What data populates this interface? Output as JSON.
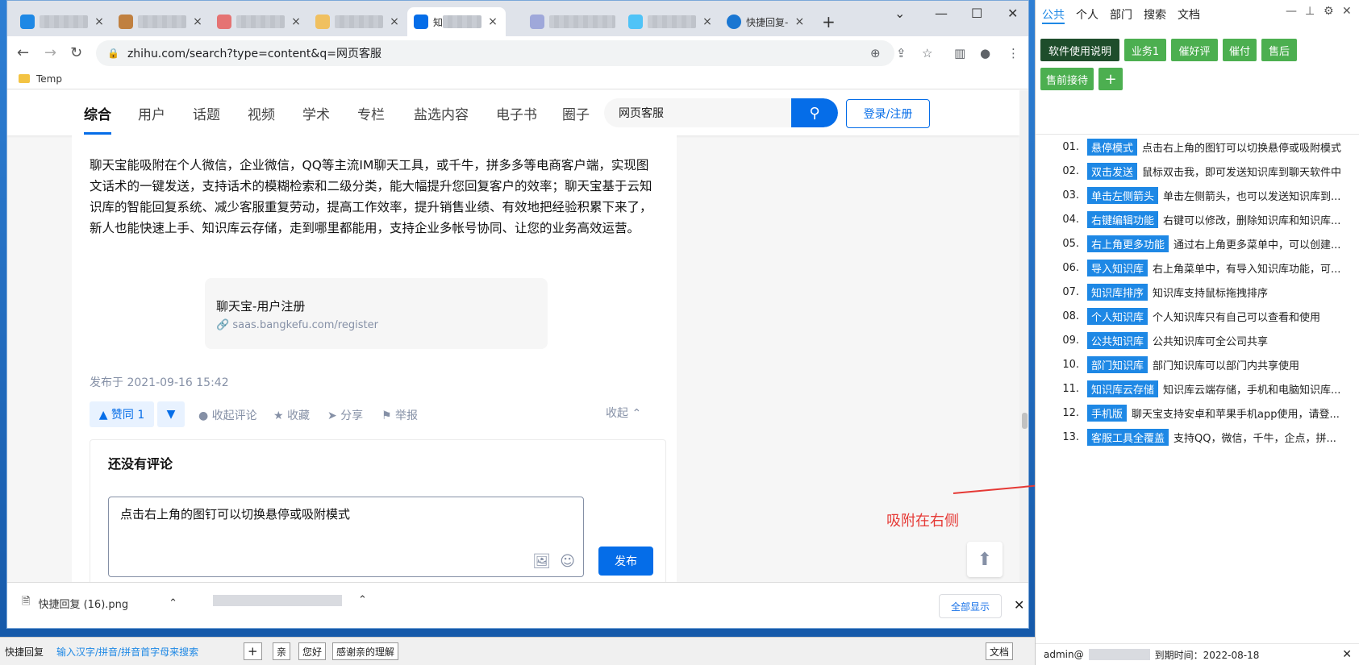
{
  "browser": {
    "tabs": [
      {
        "label": "",
        "close": "×",
        "color": "#1e88e5"
      },
      {
        "label": "",
        "close": "×",
        "color": "#c08040"
      },
      {
        "label": "",
        "close": "×",
        "color": "#e57373"
      },
      {
        "label": "",
        "close": "×",
        "color": "#f0c060"
      },
      {
        "label": "知 ",
        "close": "×",
        "color": "#056de8"
      },
      {
        "label": "",
        "close": "",
        "color": "#9fa8da"
      },
      {
        "label": "",
        "close": "×",
        "color": "#4fc3f7"
      },
      {
        "label": "快捷回复-",
        "close": "×",
        "color": "#1976d2"
      }
    ],
    "new_tab": "+",
    "url": "zhihu.com/search?type=content&q=网页客服",
    "bookmark": "Temp"
  },
  "zhihu": {
    "tabs": [
      "综合",
      "用户",
      "话题",
      "视频",
      "学术",
      "专栏",
      "盐选内容",
      "电子书",
      "圈子"
    ],
    "search_value": "网页客服",
    "login": "登录/注册",
    "answer": "聊天宝能吸附在个人微信，企业微信，QQ等主流IM聊天工具，或千牛，拼多多等电商客户端，实现图文话术的一键发送，支持话术的模糊检索和二级分类，能大幅提升您回复客户的效率；聊天宝基于云知识库的智能回复系统、减少客服重复劳动，提高工作效率，提升销售业绩、有效地把经验积累下来了，新人也能快速上手、知识库云存储，走到哪里都能用，支持企业多帐号协同、让您的业务高效运营。",
    "link_title": "聊天宝-用户注册",
    "link_url": "saas.bangkefu.com/register",
    "publish_time": "发布于 2021-09-16 15:42",
    "vote_up": "▲ 赞同 1",
    "vote_down": "▼",
    "actions": [
      "收起评论",
      "收藏",
      "分享",
      "举报"
    ],
    "collapse": "收起",
    "no_comment": "还没有评论",
    "comment_text": "点击右上角的图钉可以切换悬停或吸附模式",
    "post": "发布"
  },
  "annotation": "吸附在右侧",
  "downloads": {
    "file1": "快捷回复 (16).png",
    "show_all": "全部显示"
  },
  "panel": {
    "tabs": [
      "公共",
      "个人",
      "部门",
      "搜索",
      "文档"
    ],
    "buttons": [
      {
        "label": "软件使用说明",
        "color": "#1e4d2b"
      },
      {
        "label": "业务1",
        "color": "#4caf50"
      },
      {
        "label": "催好评",
        "color": "#4caf50"
      },
      {
        "label": "催付",
        "color": "#4caf50"
      },
      {
        "label": "售后",
        "color": "#4caf50"
      },
      {
        "label": "售前接待",
        "color": "#4caf50"
      },
      {
        "label": "+",
        "color": "#4caf50"
      }
    ],
    "items": [
      {
        "num": "01.",
        "tag": "悬停模式",
        "desc": "点击右上角的图钉可以切换悬停或吸附模式"
      },
      {
        "num": "02.",
        "tag": "双击发送",
        "desc": "鼠标双击我，即可发送知识库到聊天软件中"
      },
      {
        "num": "03.",
        "tag": "单击左侧箭头",
        "desc": "单击左侧箭头，也可以发送知识库到..."
      },
      {
        "num": "04.",
        "tag": "右键编辑功能",
        "desc": "右键可以修改，删除知识库和知识库..."
      },
      {
        "num": "05.",
        "tag": "右上角更多功能",
        "desc": "通过右上角更多菜单中，可以创建..."
      },
      {
        "num": "06.",
        "tag": "导入知识库",
        "desc": "右上角菜单中，有导入知识库功能，可..."
      },
      {
        "num": "07.",
        "tag": "知识库排序",
        "desc": "知识库支持鼠标拖拽排序"
      },
      {
        "num": "08.",
        "tag": "个人知识库",
        "desc": "个人知识库只有自己可以查看和使用"
      },
      {
        "num": "09.",
        "tag": "公共知识库",
        "desc": "公共知识库可全公司共享"
      },
      {
        "num": "10.",
        "tag": "部门知识库",
        "desc": "部门知识库可以部门内共享使用"
      },
      {
        "num": "11.",
        "tag": "知识库云存储",
        "desc": "知识库云端存储，手机和电脑知识库..."
      },
      {
        "num": "12.",
        "tag": "手机版",
        "desc": "聊天宝支持安卓和苹果手机app使用，请登..."
      },
      {
        "num": "13.",
        "tag": "客服工具全覆盖",
        "desc": "支持QQ，微信，千牛，企点，拼..."
      }
    ],
    "footer_user": "admin@",
    "footer_expire": "到期时间：2022-08-18"
  },
  "bottombar": {
    "app": "快捷回复",
    "search_placeholder": "输入汉字/拼音/拼音首字母来搜索",
    "add": "+",
    "quick": [
      "亲",
      "您好",
      "感谢亲的理解"
    ],
    "doc": "文档"
  }
}
